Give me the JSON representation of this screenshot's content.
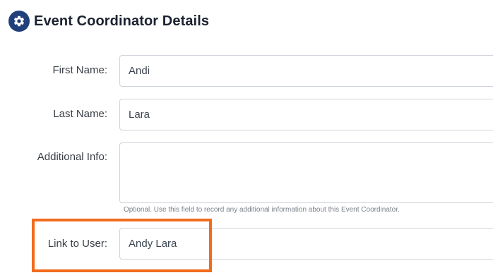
{
  "header": {
    "icon": "gear-icon",
    "title": "Event Coordinator Details",
    "icon_color": "#213f7a"
  },
  "form": {
    "first_name": {
      "label": "First Name:",
      "value": "Andi"
    },
    "last_name": {
      "label": "Last Name:",
      "value": "Lara"
    },
    "additional_info": {
      "label": "Additional Info:",
      "value": "",
      "help": "Optional. Use this field to record any additional information about this Event Coordinator."
    },
    "link_to_user": {
      "label": "Link to User:",
      "value": "Andy Lara"
    }
  },
  "highlight": {
    "color": "#f26b1d",
    "target": "link-to-user"
  }
}
